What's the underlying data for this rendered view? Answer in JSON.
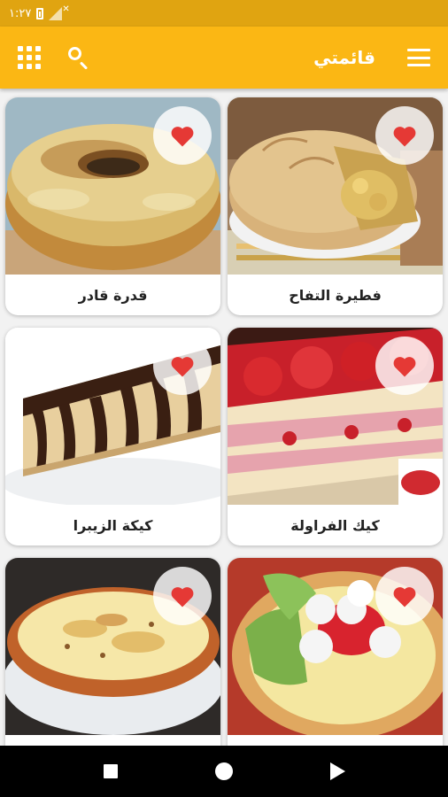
{
  "status_bar": {
    "time": "١:٢٧"
  },
  "app_bar": {
    "title": "قائمتي",
    "icons": [
      "grid-icon",
      "search-icon",
      "menu-icon"
    ]
  },
  "colors": {
    "accent": "#fbb714",
    "status_bar": "#e0a411",
    "heart": "#e53935"
  },
  "recipes": [
    {
      "label": "فطيرة التفاح",
      "favorite": true
    },
    {
      "label": "قدرة قادر",
      "favorite": true
    },
    {
      "label": "كيك الفراولة",
      "favorite": true
    },
    {
      "label": "كيكة الزيبرا",
      "favorite": true
    },
    {
      "label": "",
      "favorite": true
    },
    {
      "label": "",
      "favorite": true
    }
  ],
  "nav_bar": {
    "icons": [
      "recents-icon",
      "home-icon",
      "back-icon"
    ]
  }
}
